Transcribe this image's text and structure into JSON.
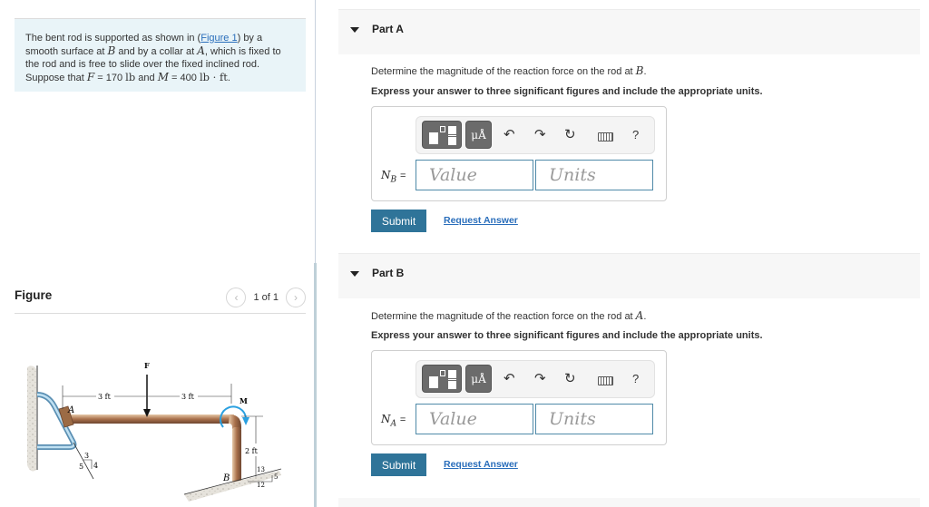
{
  "problem": {
    "text_1": "The bent rod is supported as shown in (",
    "figure_link": "Figure 1",
    "text_2": ") by a smooth surface at ",
    "var_B": "B",
    "text_3": " and by a collar at ",
    "var_A": "A",
    "text_4": ", which is fixed to the rod and is free to slide over the fixed inclined rod. Suppose that ",
    "var_F": "F",
    "text_5": " = 170 ",
    "unit_lb": "lb",
    "text_6": " and ",
    "var_M": "M",
    "text_7": " = 400 ",
    "unit_lbft": "lb · ft",
    "text_8": "."
  },
  "figure_panel": {
    "title": "Figure",
    "pager_text": "1 of 1",
    "prev_icon": "chevron-left-icon",
    "next_icon": "chevron-right-icon",
    "labels": {
      "F": "F",
      "M": "M",
      "A": "A",
      "B": "B",
      "dim_left": "3 ft",
      "dim_right": "3 ft",
      "dim_height": "2 ft",
      "slope_A_3": "3",
      "slope_A_4": "4",
      "slope_A_5": "5",
      "slope_B_13": "13",
      "slope_B_5": "5",
      "slope_B_12": "12"
    }
  },
  "parts": [
    {
      "label": "Part A",
      "question_pre": "Determine the magnitude of the reaction force on the rod at ",
      "question_var": "B",
      "question_post": ".",
      "instruction": "Express your answer to three significant figures and include the appropriate units.",
      "eq_var": "N",
      "eq_sub": "B",
      "eq_sign": "=",
      "value_placeholder": "Value",
      "units_placeholder": "Units",
      "submit_label": "Submit",
      "request_label": "Request Answer"
    },
    {
      "label": "Part B",
      "question_pre": "Determine the magnitude of the reaction force on the rod at ",
      "question_var": "A",
      "question_post": ".",
      "instruction": "Express your answer to three significant figures and include the appropriate units.",
      "eq_var": "N",
      "eq_sub": "A",
      "eq_sign": "=",
      "value_placeholder": "Value",
      "units_placeholder": "Units",
      "submit_label": "Submit",
      "request_label": "Request Answer"
    }
  ],
  "toolbar": {
    "units_label": "μÅ",
    "undo_icon": "↶",
    "redo_icon": "↷",
    "reset_icon": "↻",
    "help_label": "?"
  },
  "colors": {
    "accent": "#2f7499",
    "link": "#2a6ebb",
    "problem_bg": "#e9f4f8",
    "part_header_bg": "#f7f7f7",
    "input_border": "#4f8aa8"
  }
}
